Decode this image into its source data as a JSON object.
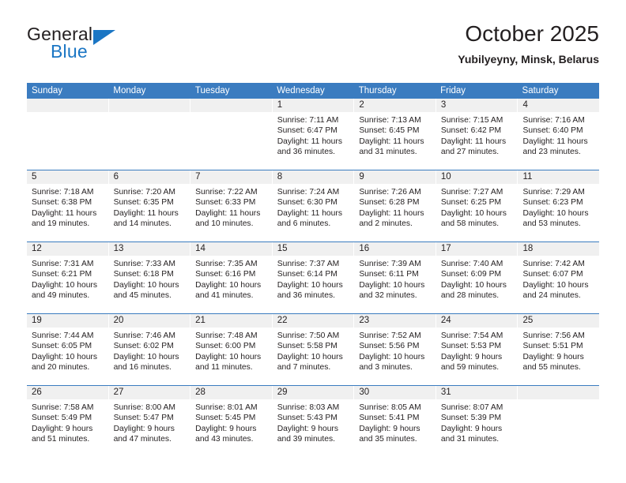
{
  "brand": {
    "name_dark": "General",
    "name_blue": "Blue",
    "accent_color": "#1b76c4"
  },
  "header": {
    "title": "October 2025",
    "location": "Yubilyeyny, Minsk, Belarus"
  },
  "theme": {
    "header_bar_color": "#3b7cc0",
    "daynum_strip_color": "#f0f0f0",
    "text_color": "#231f20"
  },
  "weekdays": [
    "Sunday",
    "Monday",
    "Tuesday",
    "Wednesday",
    "Thursday",
    "Friday",
    "Saturday"
  ],
  "weeks": [
    [
      {
        "day": "",
        "empty": true
      },
      {
        "day": "",
        "empty": true
      },
      {
        "day": "",
        "empty": true
      },
      {
        "day": "1",
        "sunrise": "Sunrise: 7:11 AM",
        "sunset": "Sunset: 6:47 PM",
        "daylight_1": "Daylight: 11 hours",
        "daylight_2": "and 36 minutes."
      },
      {
        "day": "2",
        "sunrise": "Sunrise: 7:13 AM",
        "sunset": "Sunset: 6:45 PM",
        "daylight_1": "Daylight: 11 hours",
        "daylight_2": "and 31 minutes."
      },
      {
        "day": "3",
        "sunrise": "Sunrise: 7:15 AM",
        "sunset": "Sunset: 6:42 PM",
        "daylight_1": "Daylight: 11 hours",
        "daylight_2": "and 27 minutes."
      },
      {
        "day": "4",
        "sunrise": "Sunrise: 7:16 AM",
        "sunset": "Sunset: 6:40 PM",
        "daylight_1": "Daylight: 11 hours",
        "daylight_2": "and 23 minutes."
      }
    ],
    [
      {
        "day": "5",
        "sunrise": "Sunrise: 7:18 AM",
        "sunset": "Sunset: 6:38 PM",
        "daylight_1": "Daylight: 11 hours",
        "daylight_2": "and 19 minutes."
      },
      {
        "day": "6",
        "sunrise": "Sunrise: 7:20 AM",
        "sunset": "Sunset: 6:35 PM",
        "daylight_1": "Daylight: 11 hours",
        "daylight_2": "and 14 minutes."
      },
      {
        "day": "7",
        "sunrise": "Sunrise: 7:22 AM",
        "sunset": "Sunset: 6:33 PM",
        "daylight_1": "Daylight: 11 hours",
        "daylight_2": "and 10 minutes."
      },
      {
        "day": "8",
        "sunrise": "Sunrise: 7:24 AM",
        "sunset": "Sunset: 6:30 PM",
        "daylight_1": "Daylight: 11 hours",
        "daylight_2": "and 6 minutes."
      },
      {
        "day": "9",
        "sunrise": "Sunrise: 7:26 AM",
        "sunset": "Sunset: 6:28 PM",
        "daylight_1": "Daylight: 11 hours",
        "daylight_2": "and 2 minutes."
      },
      {
        "day": "10",
        "sunrise": "Sunrise: 7:27 AM",
        "sunset": "Sunset: 6:25 PM",
        "daylight_1": "Daylight: 10 hours",
        "daylight_2": "and 58 minutes."
      },
      {
        "day": "11",
        "sunrise": "Sunrise: 7:29 AM",
        "sunset": "Sunset: 6:23 PM",
        "daylight_1": "Daylight: 10 hours",
        "daylight_2": "and 53 minutes."
      }
    ],
    [
      {
        "day": "12",
        "sunrise": "Sunrise: 7:31 AM",
        "sunset": "Sunset: 6:21 PM",
        "daylight_1": "Daylight: 10 hours",
        "daylight_2": "and 49 minutes."
      },
      {
        "day": "13",
        "sunrise": "Sunrise: 7:33 AM",
        "sunset": "Sunset: 6:18 PM",
        "daylight_1": "Daylight: 10 hours",
        "daylight_2": "and 45 minutes."
      },
      {
        "day": "14",
        "sunrise": "Sunrise: 7:35 AM",
        "sunset": "Sunset: 6:16 PM",
        "daylight_1": "Daylight: 10 hours",
        "daylight_2": "and 41 minutes."
      },
      {
        "day": "15",
        "sunrise": "Sunrise: 7:37 AM",
        "sunset": "Sunset: 6:14 PM",
        "daylight_1": "Daylight: 10 hours",
        "daylight_2": "and 36 minutes."
      },
      {
        "day": "16",
        "sunrise": "Sunrise: 7:39 AM",
        "sunset": "Sunset: 6:11 PM",
        "daylight_1": "Daylight: 10 hours",
        "daylight_2": "and 32 minutes."
      },
      {
        "day": "17",
        "sunrise": "Sunrise: 7:40 AM",
        "sunset": "Sunset: 6:09 PM",
        "daylight_1": "Daylight: 10 hours",
        "daylight_2": "and 28 minutes."
      },
      {
        "day": "18",
        "sunrise": "Sunrise: 7:42 AM",
        "sunset": "Sunset: 6:07 PM",
        "daylight_1": "Daylight: 10 hours",
        "daylight_2": "and 24 minutes."
      }
    ],
    [
      {
        "day": "19",
        "sunrise": "Sunrise: 7:44 AM",
        "sunset": "Sunset: 6:05 PM",
        "daylight_1": "Daylight: 10 hours",
        "daylight_2": "and 20 minutes."
      },
      {
        "day": "20",
        "sunrise": "Sunrise: 7:46 AM",
        "sunset": "Sunset: 6:02 PM",
        "daylight_1": "Daylight: 10 hours",
        "daylight_2": "and 16 minutes."
      },
      {
        "day": "21",
        "sunrise": "Sunrise: 7:48 AM",
        "sunset": "Sunset: 6:00 PM",
        "daylight_1": "Daylight: 10 hours",
        "daylight_2": "and 11 minutes."
      },
      {
        "day": "22",
        "sunrise": "Sunrise: 7:50 AM",
        "sunset": "Sunset: 5:58 PM",
        "daylight_1": "Daylight: 10 hours",
        "daylight_2": "and 7 minutes."
      },
      {
        "day": "23",
        "sunrise": "Sunrise: 7:52 AM",
        "sunset": "Sunset: 5:56 PM",
        "daylight_1": "Daylight: 10 hours",
        "daylight_2": "and 3 minutes."
      },
      {
        "day": "24",
        "sunrise": "Sunrise: 7:54 AM",
        "sunset": "Sunset: 5:53 PM",
        "daylight_1": "Daylight: 9 hours",
        "daylight_2": "and 59 minutes."
      },
      {
        "day": "25",
        "sunrise": "Sunrise: 7:56 AM",
        "sunset": "Sunset: 5:51 PM",
        "daylight_1": "Daylight: 9 hours",
        "daylight_2": "and 55 minutes."
      }
    ],
    [
      {
        "day": "26",
        "sunrise": "Sunrise: 7:58 AM",
        "sunset": "Sunset: 5:49 PM",
        "daylight_1": "Daylight: 9 hours",
        "daylight_2": "and 51 minutes."
      },
      {
        "day": "27",
        "sunrise": "Sunrise: 8:00 AM",
        "sunset": "Sunset: 5:47 PM",
        "daylight_1": "Daylight: 9 hours",
        "daylight_2": "and 47 minutes."
      },
      {
        "day": "28",
        "sunrise": "Sunrise: 8:01 AM",
        "sunset": "Sunset: 5:45 PM",
        "daylight_1": "Daylight: 9 hours",
        "daylight_2": "and 43 minutes."
      },
      {
        "day": "29",
        "sunrise": "Sunrise: 8:03 AM",
        "sunset": "Sunset: 5:43 PM",
        "daylight_1": "Daylight: 9 hours",
        "daylight_2": "and 39 minutes."
      },
      {
        "day": "30",
        "sunrise": "Sunrise: 8:05 AM",
        "sunset": "Sunset: 5:41 PM",
        "daylight_1": "Daylight: 9 hours",
        "daylight_2": "and 35 minutes."
      },
      {
        "day": "31",
        "sunrise": "Sunrise: 8:07 AM",
        "sunset": "Sunset: 5:39 PM",
        "daylight_1": "Daylight: 9 hours",
        "daylight_2": "and 31 minutes."
      },
      {
        "day": "",
        "empty": true
      }
    ]
  ]
}
